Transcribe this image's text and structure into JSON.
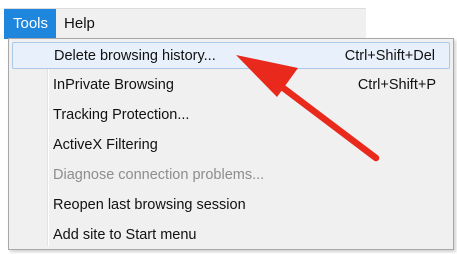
{
  "menubar": {
    "items": [
      {
        "label": "Tools",
        "active": true
      },
      {
        "label": "Help",
        "active": false
      }
    ]
  },
  "menu": {
    "items": [
      {
        "label": "Delete browsing history...",
        "shortcut": "Ctrl+Shift+Del",
        "highlighted": true,
        "disabled": false
      },
      {
        "label": "InPrivate Browsing",
        "shortcut": "Ctrl+Shift+P",
        "highlighted": false,
        "disabled": false
      },
      {
        "label": "Tracking Protection...",
        "shortcut": "",
        "highlighted": false,
        "disabled": false
      },
      {
        "label": "ActiveX Filtering",
        "shortcut": "",
        "highlighted": false,
        "disabled": false
      },
      {
        "label": "Diagnose connection problems...",
        "shortcut": "",
        "highlighted": false,
        "disabled": true
      },
      {
        "label": "Reopen last browsing session",
        "shortcut": "",
        "highlighted": false,
        "disabled": false
      },
      {
        "label": "Add site to Start menu",
        "shortcut": "",
        "highlighted": false,
        "disabled": false
      }
    ]
  },
  "annotation": {
    "icon": "red-arrow-icon",
    "color": "#e8291c"
  },
  "colors": {
    "active_menu": "#1f86dd",
    "highlight_fill": "#e8f1fb",
    "highlight_border": "#a9c8ea",
    "menu_background": "#f0f0f0"
  }
}
